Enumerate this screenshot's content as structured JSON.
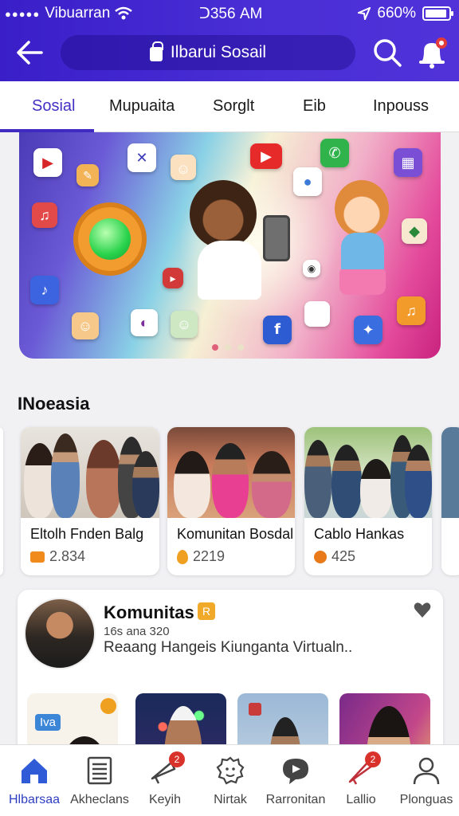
{
  "status": {
    "carrier": "Vibuarran",
    "time": "ᑐ356 AM",
    "battery": "660%"
  },
  "header": {
    "title": "Ilbarui Sosail"
  },
  "tabs": [
    {
      "label": "Sosial",
      "active": true
    },
    {
      "label": "Mupuaita"
    },
    {
      "label": "Sorglt"
    },
    {
      "label": "Eib"
    },
    {
      "label": "Inpouss"
    }
  ],
  "section": {
    "title": "INoeasia"
  },
  "cards": [
    {
      "title": "Eltolh Fnden Balg",
      "count": "2.834",
      "icon": "message-icon",
      "color": "#f08a1c"
    },
    {
      "title": "Komunitan Bosdal",
      "count": "2219",
      "icon": "fire-icon",
      "color": "#f0a020"
    },
    {
      "title": "Cablo Hankas",
      "count": "425",
      "icon": "group-icon",
      "color": "#e87a1a"
    }
  ],
  "community": {
    "title": "Komunitas",
    "subtitle": "16s ana 320",
    "description": "Reaang Hangeis Kiunganta Virtualn..",
    "badge": "R",
    "thumb_label": "Iva"
  },
  "nav": [
    {
      "label": "Hlbarsaa",
      "icon": "home-icon",
      "active": true
    },
    {
      "label": "Akheclans",
      "icon": "document-icon"
    },
    {
      "label": "Keyih",
      "icon": "megaphone-icon",
      "badge": "2"
    },
    {
      "label": "Nirtak",
      "icon": "face-icon"
    },
    {
      "label": "Rarronitan",
      "icon": "chat-bubble-icon"
    },
    {
      "label": "Lallio",
      "icon": "rocket-icon",
      "badge": "2"
    },
    {
      "label": "Plonguas",
      "icon": "person-icon"
    }
  ],
  "colors": {
    "primary": "#3a1fc9",
    "active_nav": "#2f3fbf"
  }
}
